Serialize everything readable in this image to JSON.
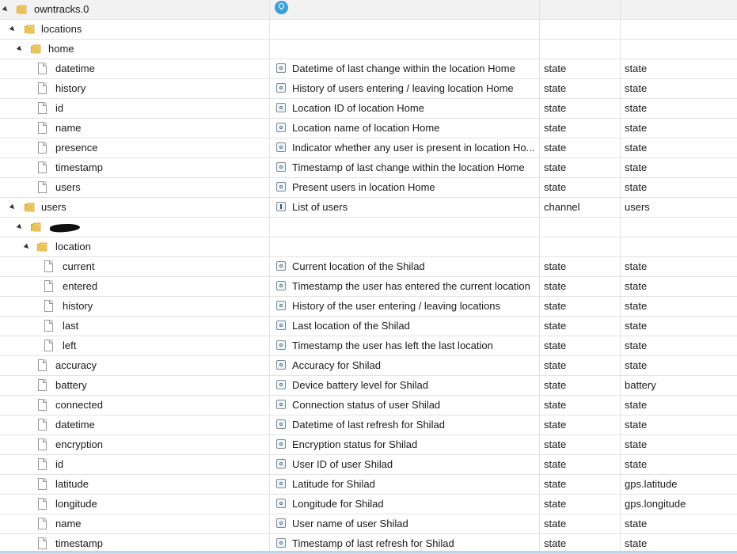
{
  "tree": {
    "rows": [
      {
        "name": "owntracks.0",
        "depth": 0,
        "kind": "folder",
        "expanded": true,
        "desc": "",
        "type": "",
        "role": "",
        "icon": "location-pin-icon",
        "first": true
      },
      {
        "name": "locations",
        "depth": 1,
        "kind": "folder",
        "expanded": true,
        "desc": "",
        "type": "",
        "role": ""
      },
      {
        "name": "home",
        "depth": 2,
        "kind": "folder",
        "expanded": true,
        "desc": "",
        "type": "",
        "role": ""
      },
      {
        "name": "datetime",
        "depth": 3,
        "kind": "state",
        "desc": "Datetime of last change within the location Home",
        "type": "state",
        "role": "state"
      },
      {
        "name": "history",
        "depth": 3,
        "kind": "state",
        "desc": "History of users entering / leaving location Home",
        "type": "state",
        "role": "state"
      },
      {
        "name": "id",
        "depth": 3,
        "kind": "state",
        "desc": "Location ID of location Home",
        "type": "state",
        "role": "state"
      },
      {
        "name": "name",
        "depth": 3,
        "kind": "state",
        "desc": "Location name of location Home",
        "type": "state",
        "role": "state"
      },
      {
        "name": "presence",
        "depth": 3,
        "kind": "state",
        "desc": "Indicator whether any user is present in location Ho...",
        "type": "state",
        "role": "state"
      },
      {
        "name": "timestamp",
        "depth": 3,
        "kind": "state",
        "desc": "Timestamp of last change within the location Home",
        "type": "state",
        "role": "state"
      },
      {
        "name": "users",
        "depth": 3,
        "kind": "state",
        "desc": "Present users in location Home",
        "type": "state",
        "role": "state"
      },
      {
        "name": "users",
        "depth": 1,
        "kind": "folder",
        "expanded": true,
        "desc": "List of users",
        "type": "channel",
        "role": "users",
        "icon": "info-icon"
      },
      {
        "name": "",
        "depth": 2,
        "kind": "folder",
        "expanded": true,
        "redacted": true,
        "desc": "",
        "type": "",
        "role": ""
      },
      {
        "name": "location",
        "depth": 3,
        "kind": "folder",
        "expanded": true,
        "desc": "",
        "type": "",
        "role": ""
      },
      {
        "name": "current",
        "depth": 4,
        "kind": "state",
        "desc": "Current location of the Shilad",
        "type": "state",
        "role": "state"
      },
      {
        "name": "entered",
        "depth": 4,
        "kind": "state",
        "desc": "Timestamp the user has entered the current location",
        "type": "state",
        "role": "state"
      },
      {
        "name": "history",
        "depth": 4,
        "kind": "state",
        "desc": "History of the user entering / leaving locations",
        "type": "state",
        "role": "state"
      },
      {
        "name": "last",
        "depth": 4,
        "kind": "state",
        "desc": "Last location of the Shilad",
        "type": "state",
        "role": "state"
      },
      {
        "name": "left",
        "depth": 4,
        "kind": "state",
        "desc": "Timestamp the user has left the last location",
        "type": "state",
        "role": "state"
      },
      {
        "name": "accuracy",
        "depth": 3,
        "kind": "state",
        "desc": "Accuracy for Shilad",
        "type": "state",
        "role": "state"
      },
      {
        "name": "battery",
        "depth": 3,
        "kind": "state",
        "desc": "Device battery level for Shilad",
        "type": "state",
        "role": "battery"
      },
      {
        "name": "connected",
        "depth": 3,
        "kind": "state",
        "desc": "Connection status of user Shilad",
        "type": "state",
        "role": "state"
      },
      {
        "name": "datetime",
        "depth": 3,
        "kind": "state",
        "desc": "Datetime of last refresh for Shilad",
        "type": "state",
        "role": "state"
      },
      {
        "name": "encryption",
        "depth": 3,
        "kind": "state",
        "desc": "Encryption status for Shilad",
        "type": "state",
        "role": "state"
      },
      {
        "name": "id",
        "depth": 3,
        "kind": "state",
        "desc": "User ID of user Shilad",
        "type": "state",
        "role": "state"
      },
      {
        "name": "latitude",
        "depth": 3,
        "kind": "state",
        "desc": "Latitude for Shilad",
        "type": "state",
        "role": "gps.latitude"
      },
      {
        "name": "longitude",
        "depth": 3,
        "kind": "state",
        "desc": "Longitude for Shilad",
        "type": "state",
        "role": "gps.longitude"
      },
      {
        "name": "name",
        "depth": 3,
        "kind": "state",
        "desc": "User name of user Shilad",
        "type": "state",
        "role": "state"
      },
      {
        "name": "timestamp",
        "depth": 3,
        "kind": "state",
        "desc": "Timestamp of last refresh for Shilad",
        "type": "state",
        "role": "state"
      }
    ]
  },
  "colors": {
    "folder": "#e8c35a",
    "pin": "#3aa0d8"
  }
}
